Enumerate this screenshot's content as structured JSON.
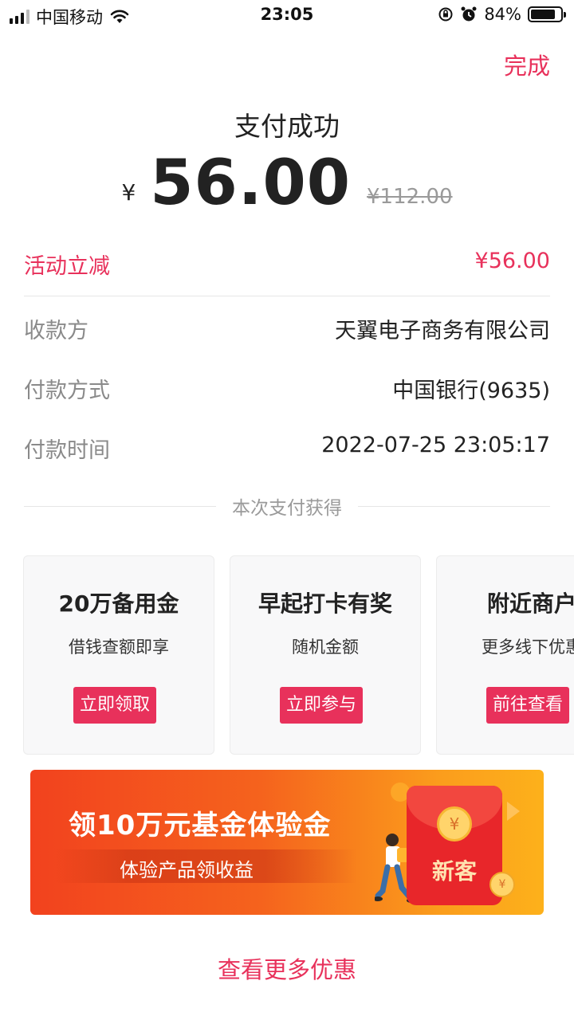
{
  "status_bar": {
    "carrier": "中国移动",
    "time": "23:05",
    "battery": "84%",
    "battery_level": 0.84
  },
  "header": {
    "done_label": "完成"
  },
  "payment": {
    "title": "支付成功",
    "currency": "¥",
    "amount": "56.00",
    "original_amount": "¥112.00"
  },
  "details": [
    {
      "label": "活动立减",
      "value": "¥56.00",
      "highlight": true
    },
    {
      "label": "收款方",
      "value": "天翼电子商务有限公司"
    },
    {
      "label": "付款方式",
      "value": "中国银行(9635)"
    },
    {
      "label": "付款时间",
      "value": "2022-07-25 23:05:17"
    }
  ],
  "rewards_section": {
    "title": "本次支付获得"
  },
  "cards": [
    {
      "title": "20万备用金",
      "subtitle": "借钱查额即享",
      "button": "立即领取"
    },
    {
      "title": "早起打卡有奖",
      "subtitle": "随机金额",
      "button": "立即参与"
    },
    {
      "title": "附近商户",
      "subtitle": "更多线下优惠",
      "button": "前往查看"
    }
  ],
  "banner": {
    "title": "领10万元基金体验金",
    "subtitle": "体验产品领收益",
    "badge": "新客",
    "coin_symbol": "¥"
  },
  "footer": {
    "more_label": "查看更多优惠"
  },
  "colors": {
    "accent": "#e8315b",
    "banner_start": "#f2421e",
    "banner_end": "#fdb11b"
  },
  "icons": [
    "signal-icon",
    "wifi-icon",
    "lock-rotation-icon",
    "alarm-icon",
    "battery-icon",
    "red-envelope-icon",
    "coin-icon"
  ]
}
